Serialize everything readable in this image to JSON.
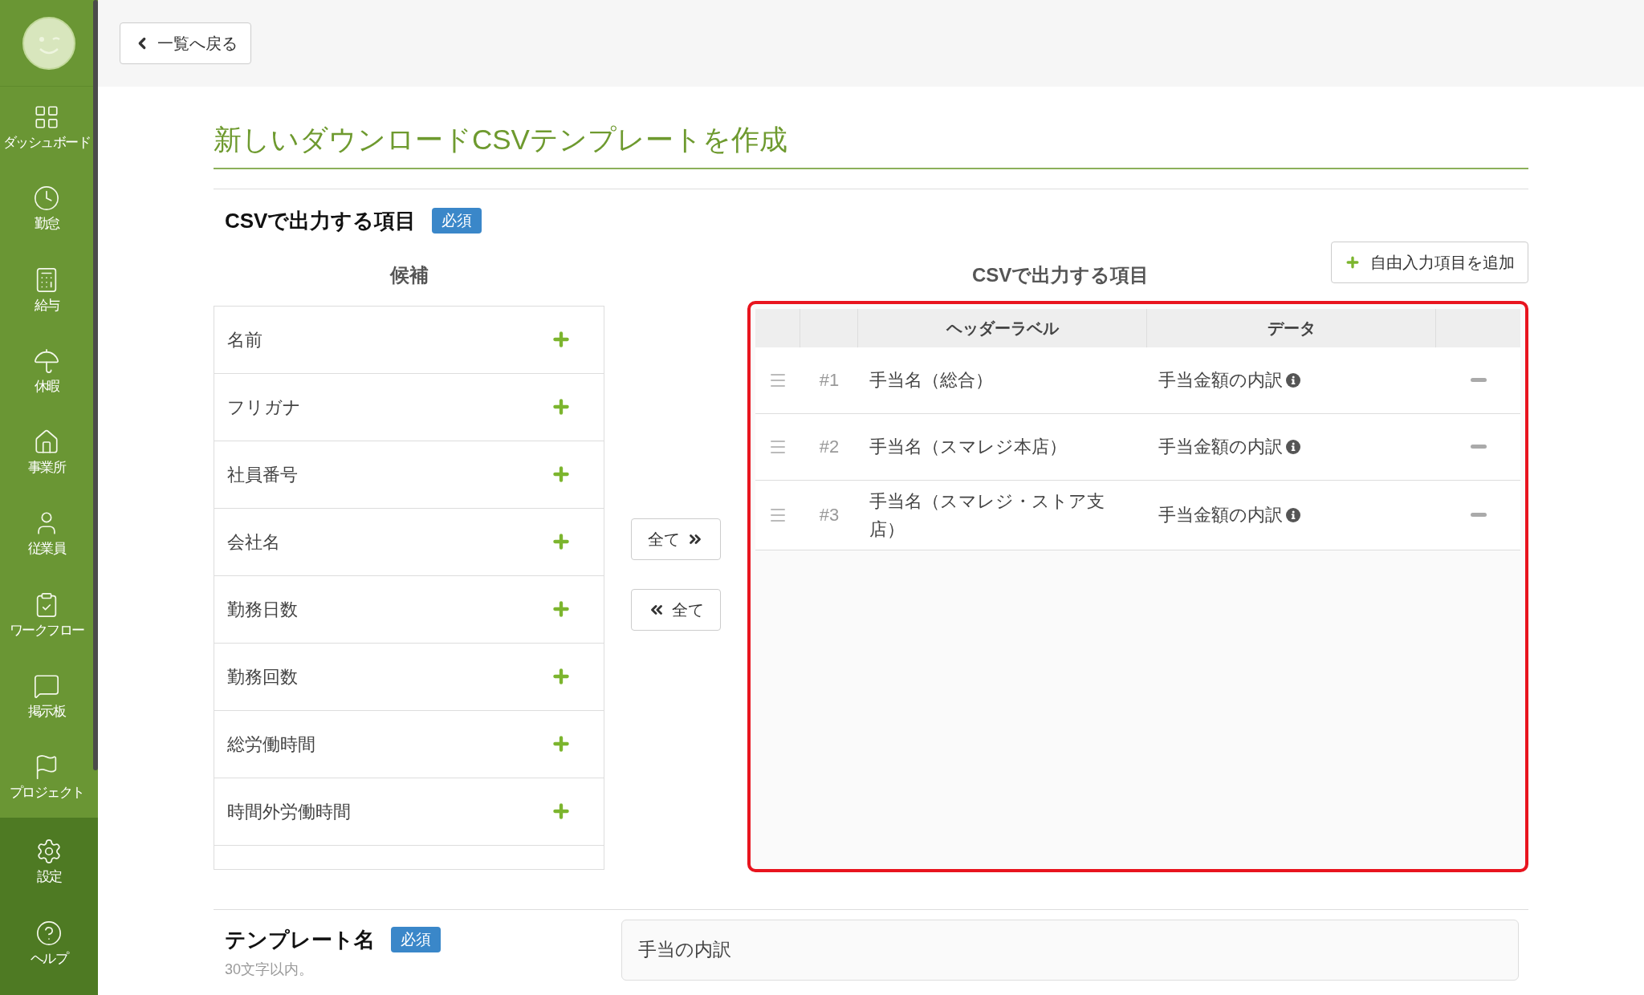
{
  "sidebar": {
    "items": [
      {
        "label": "ダッシュボード"
      },
      {
        "label": "勤怠"
      },
      {
        "label": "給与"
      },
      {
        "label": "休暇"
      },
      {
        "label": "事業所"
      },
      {
        "label": "従業員"
      },
      {
        "label": "ワークフロー"
      },
      {
        "label": "掲示板"
      },
      {
        "label": "プロジェクト"
      }
    ],
    "footer_items": [
      {
        "label": "設定"
      },
      {
        "label": "ヘルプ"
      }
    ]
  },
  "back_button": "一覧へ戻る",
  "title": "新しいダウンロードCSVテンプレートを作成",
  "csv_section": {
    "heading": "CSVで出力する項目",
    "badge": "必須",
    "candidates": {
      "heading": "候補",
      "items": [
        "名前",
        "フリガナ",
        "社員番号",
        "会社名",
        "勤務日数",
        "勤務回数",
        "総労働時間",
        "時間外労働時間"
      ]
    },
    "move_all_right": "全て",
    "move_all_left": "全て",
    "output": {
      "heading": "CSVで出力する項目",
      "add_button": "自由入力項目を追加",
      "columns": [
        "ヘッダーラベル",
        "データ"
      ],
      "rows": [
        {
          "number": "#1",
          "label": "手当名（総合）",
          "data": "手当金額の内訳"
        },
        {
          "number": "#2",
          "label": "手当名（スマレジ本店）",
          "data": "手当金額の内訳"
        },
        {
          "number": "#3",
          "label": "手当名（スマレジ・ストア支店）",
          "data": "手当金額の内訳"
        }
      ]
    }
  },
  "template_name": {
    "label": "テンプレート名",
    "badge": "必須",
    "hint": "30文字以内。",
    "value": "手当の内訳"
  }
}
